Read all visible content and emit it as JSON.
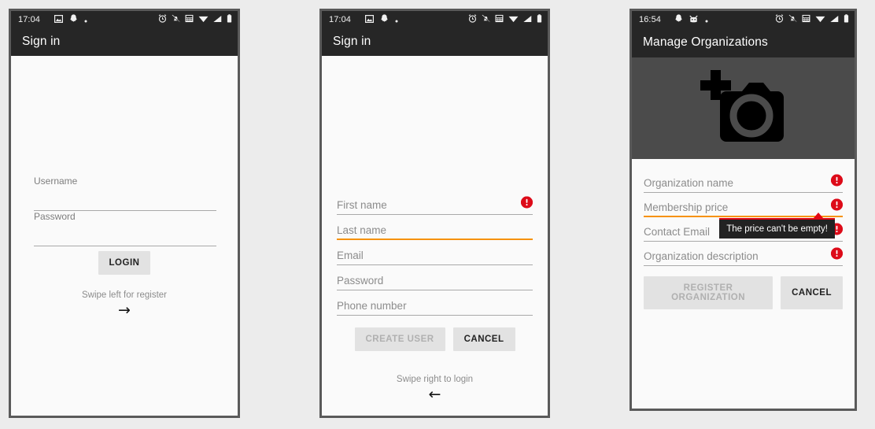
{
  "screens": [
    {
      "id": "signin-login",
      "statusbar": {
        "time": "17:04",
        "left_icons": [
          "image-icon",
          "ghost-icon",
          "dot-icon"
        ],
        "right_icons": [
          "alarm-icon",
          "bell-muted-icon",
          "calculator-icon",
          "wifi-icon",
          "signal-icon",
          "battery-icon"
        ]
      },
      "appbar": {
        "title": "Sign in"
      },
      "fields": [
        {
          "label": "Username",
          "focused": false,
          "error": false
        },
        {
          "label": "Password",
          "focused": false,
          "error": false
        }
      ],
      "buttons": [
        {
          "label": "LOGIN",
          "disabled": false
        }
      ],
      "swipe": {
        "text": "Swipe left for register",
        "arrow": "→",
        "arrow_name": "arrow-right-icon"
      }
    },
    {
      "id": "signin-register",
      "statusbar": {
        "time": "17:04",
        "left_icons": [
          "image-icon",
          "ghost-icon",
          "dot-icon"
        ],
        "right_icons": [
          "alarm-icon",
          "bell-muted-icon",
          "calculator-icon",
          "wifi-icon",
          "signal-icon",
          "battery-icon"
        ]
      },
      "appbar": {
        "title": "Sign in"
      },
      "fields": [
        {
          "label": "First name",
          "focused": false,
          "error": true
        },
        {
          "label": "Last name",
          "focused": true,
          "error": false
        },
        {
          "label": "Email",
          "focused": false,
          "error": false
        },
        {
          "label": "Password",
          "focused": false,
          "error": false
        },
        {
          "label": "Phone number",
          "focused": false,
          "error": false
        }
      ],
      "buttons": [
        {
          "label": "CREATE USER",
          "disabled": true
        },
        {
          "label": "CANCEL",
          "disabled": false
        }
      ],
      "swipe": {
        "text": "Swipe right to login",
        "arrow": "←",
        "arrow_name": "arrow-left-icon"
      }
    },
    {
      "id": "manage-organizations",
      "statusbar": {
        "time": "16:54",
        "left_icons": [
          "ghost-icon",
          "face-icon",
          "dot-icon"
        ],
        "right_icons": [
          "alarm-icon",
          "bell-muted-icon",
          "calculator-icon",
          "wifi-icon",
          "signal-icon",
          "battery-icon"
        ]
      },
      "appbar": {
        "title": "Manage Organizations"
      },
      "hero": {
        "icon": "add-photo-camera-icon"
      },
      "fields": [
        {
          "label": "Organization name",
          "focused": false,
          "error": true
        },
        {
          "label": "Membership price",
          "focused": true,
          "error": true
        },
        {
          "label": "Contact Email",
          "focused": false,
          "error": true
        },
        {
          "label": "Organization description",
          "focused": false,
          "error": true
        }
      ],
      "buttons": [
        {
          "label": "REGISTER ORGANIZATION",
          "disabled": true
        },
        {
          "label": "CANCEL",
          "disabled": false
        }
      ],
      "tooltip": {
        "text": "The price can't be empty!"
      }
    }
  ],
  "colors": {
    "page_background": "#ececec",
    "status_bar": "#262626",
    "app_bar": "#262626",
    "screen_background": "#fafafa",
    "field_underline": "#a9a9a9",
    "field_focus_underline": "#f6920a",
    "error": "#dd0b19",
    "tooltip_background": "#222222",
    "tooltip_accent": "#e30613",
    "button_background": "#e2e2e2",
    "hero_background": "#4b4b4b"
  }
}
